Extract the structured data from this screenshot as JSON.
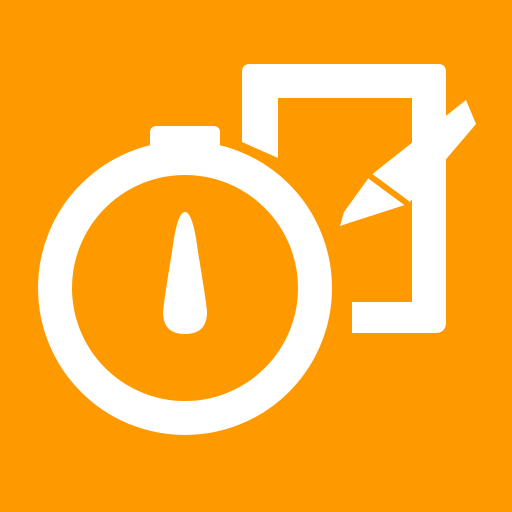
{
  "colors": {
    "background": "#FF9900",
    "foreground": "#FFFFFF"
  },
  "icon": {
    "name": "stopwatch-notepad-icon",
    "parts": [
      "stopwatch-icon",
      "notepad-icon",
      "pencil-icon"
    ]
  }
}
